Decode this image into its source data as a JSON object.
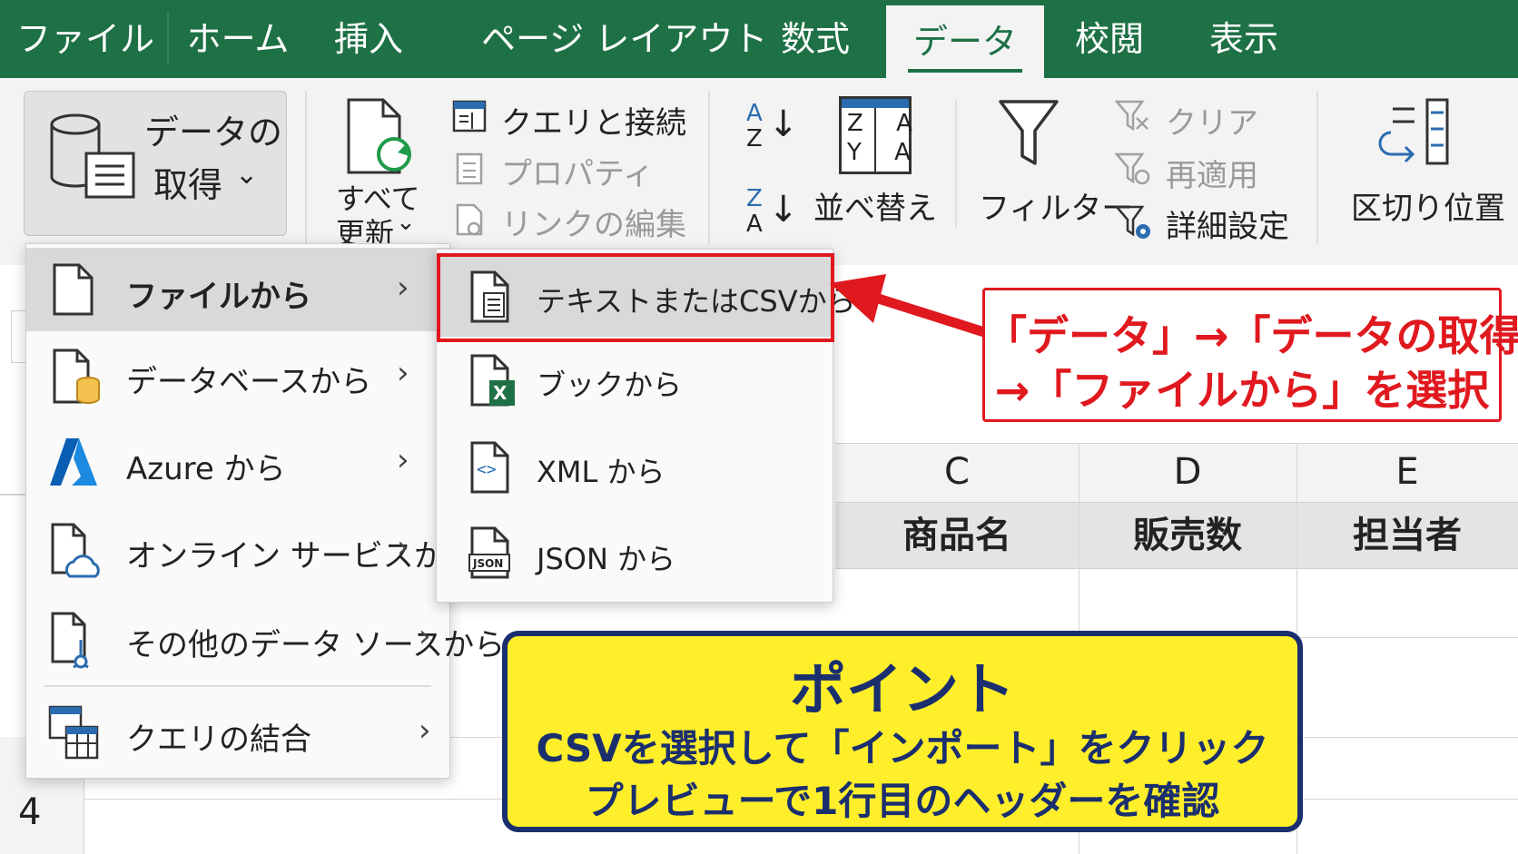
{
  "tabs": [
    "ファイル",
    "ホーム",
    "挿入",
    "ページ レイアウト",
    "数式",
    "データ",
    "校閲",
    "表示"
  ],
  "ribbon": {
    "get_data_line1": "データの",
    "get_data_line2": "取得",
    "refresh_line1": "すべて",
    "refresh_line2": "更新",
    "queries": "クエリと接続",
    "properties": "プロパティ",
    "edit_links": "リンクの編集",
    "sort_az_top": "A",
    "sort_az_bottom": "Z",
    "sort_za_top": "Z",
    "sort_za_bottom": "A",
    "sort_icon_top": "Z A",
    "sort_icon_bottom": "Y A",
    "sort": "並べ替え",
    "filter": "フィルター",
    "clear": "クリア",
    "reapply": "再適用",
    "advanced": "詳細設定",
    "text_to_columns": "区切り位置"
  },
  "sheet": {
    "columns": [
      "C",
      "D",
      "E"
    ],
    "headers": [
      "商品名",
      "販売数",
      "担当者"
    ],
    "row_number": "4"
  },
  "menu": {
    "items": [
      {
        "label": "ファイルから",
        "chevron": "›"
      },
      {
        "label": "データベースから",
        "chevron": "›"
      },
      {
        "label": "Azure から",
        "chevron": "›"
      },
      {
        "label": "オンライン サービスから",
        "chevron": "›"
      },
      {
        "label": "その他のデータ ソースから",
        "chevron": "›"
      },
      {
        "label": "クエリの結合",
        "chevron": "›"
      }
    ]
  },
  "submenu": {
    "items": [
      {
        "label": "テキストまたはCSVから"
      },
      {
        "label": "ブックから"
      },
      {
        "label": "XML から"
      },
      {
        "label": "JSON から"
      }
    ],
    "excel_badge": "X",
    "xml_badge": "<>",
    "json_badge": "JSON"
  },
  "callout_red": {
    "line1": "「データ」→「データの取得」",
    "line2": "→「ファイルから」を選択"
  },
  "callout_yellow": {
    "title": "ポイント",
    "line1": "CSVを選択して「インポート」をクリック",
    "line2": "プレビューで1行目のヘッダーを確認"
  },
  "colors": {
    "excel_green": "#1e7145",
    "highlight_red": "#e0191f",
    "point_yellow": "#ffef2a",
    "point_navy": "#1b2f6e"
  }
}
